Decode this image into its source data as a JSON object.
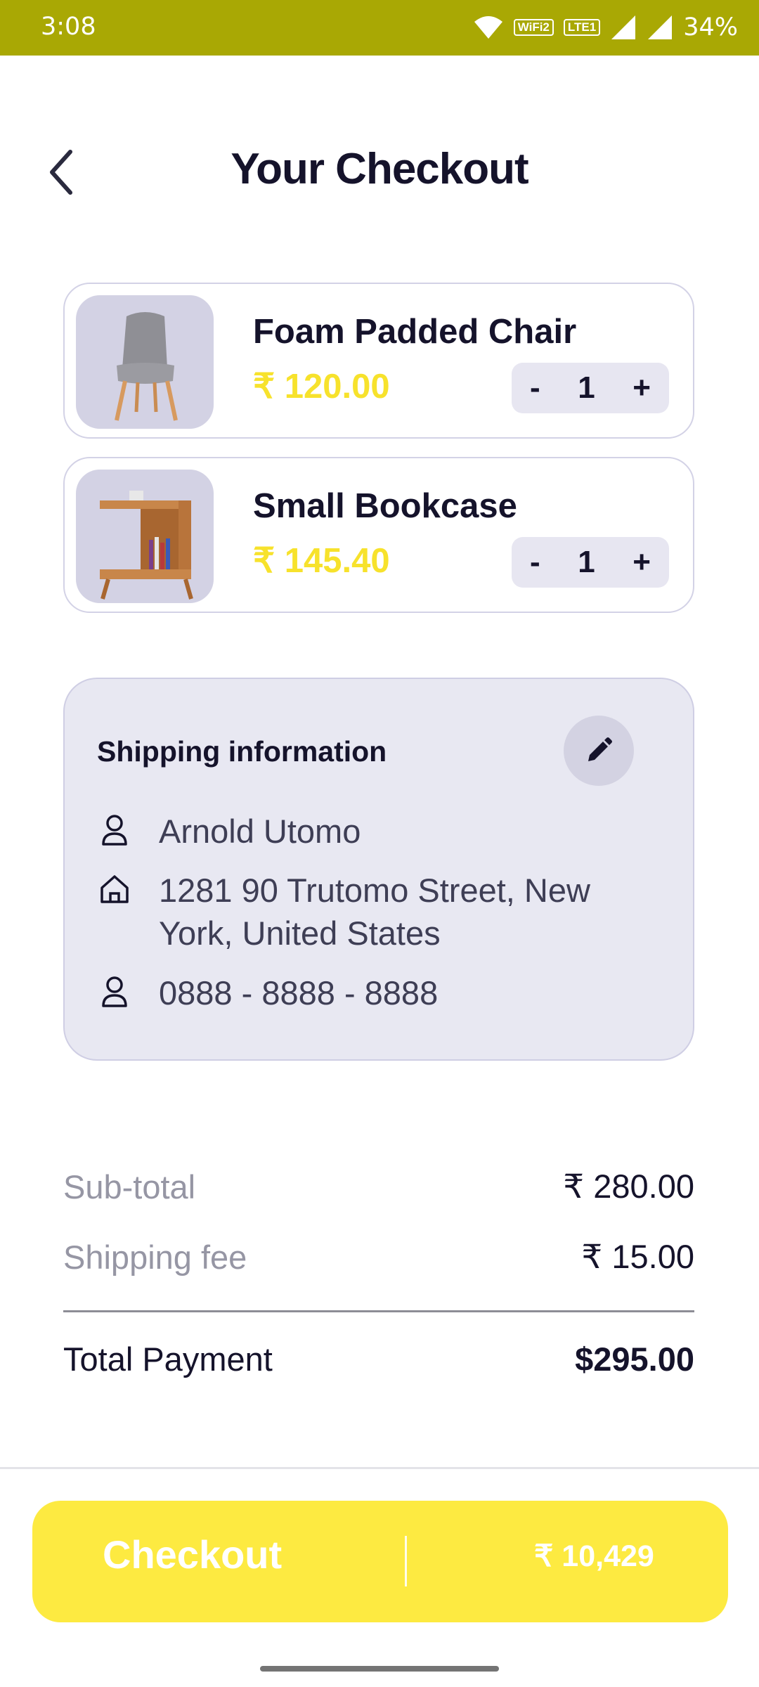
{
  "status_bar": {
    "time": "3:08",
    "wifi_badge": "WiFi2",
    "lte_badge": "LTE1",
    "battery": "34%",
    "background_color": "#a9a804"
  },
  "header": {
    "back_icon": "chevron-left-icon",
    "title": "Your Checkout"
  },
  "cart": {
    "items": [
      {
        "name": "Foam Padded Chair",
        "price": "₹ 120.00",
        "qty_minus": "-",
        "quantity": "1",
        "qty_plus": "+",
        "image": "chair-image"
      },
      {
        "name": "Small Bookcase",
        "price": "₹ 145.40",
        "qty_minus": "-",
        "quantity": "1",
        "qty_plus": "+",
        "image": "bookcase-image"
      }
    ]
  },
  "shipping": {
    "title": "Shipping information",
    "edit_icon": "pencil-icon",
    "name": "Arnold Utomo",
    "address": "1281 90 Trutomo Street, New York, United States",
    "phone": "0888 - 8888 - 8888"
  },
  "summary": {
    "subtotal_label": "Sub-total",
    "subtotal_value": "₹ 280.00",
    "shipping_label": "Shipping fee",
    "shipping_value": "₹ 15.00",
    "total_label": "Total Payment",
    "total_value": "$295.00"
  },
  "checkout": {
    "label": "Checkout",
    "amount": "₹ 10,429",
    "button_color": "#fdea41"
  },
  "colors": {
    "price_accent": "#f7e22c",
    "text_dark": "#15132b",
    "card_bg": "#e8e8f2"
  }
}
